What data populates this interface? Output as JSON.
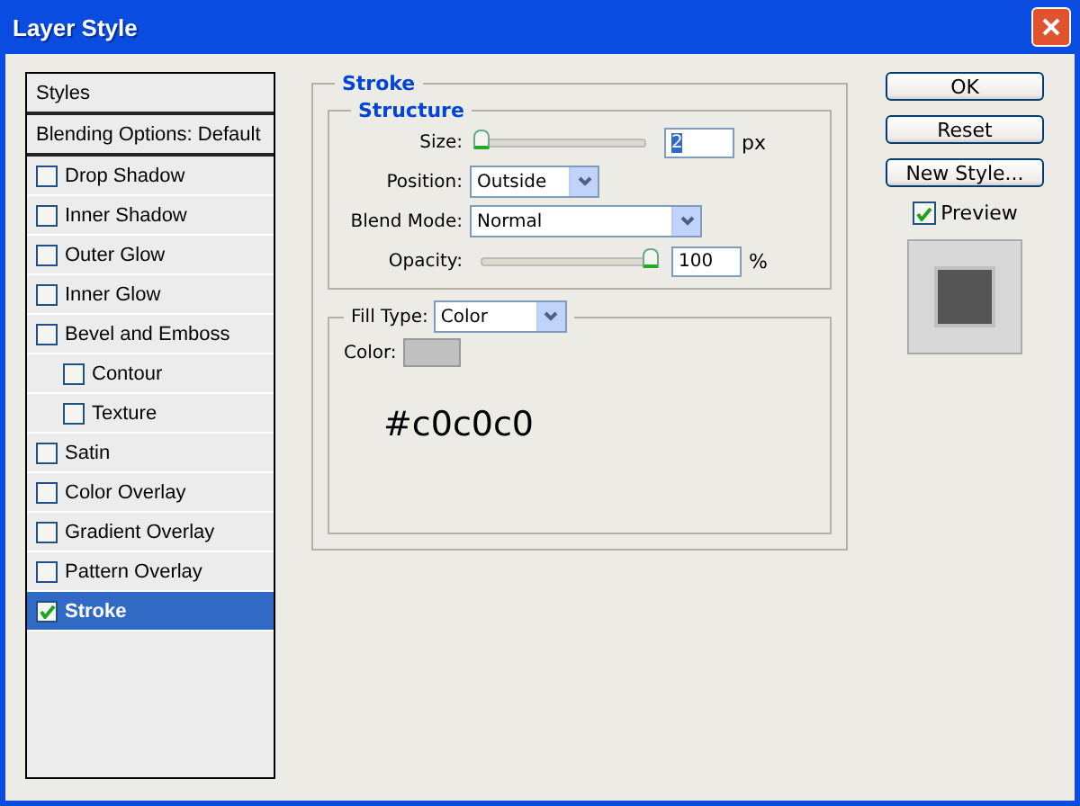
{
  "window": {
    "title": "Layer Style"
  },
  "sidebar": {
    "items": [
      {
        "label": "Styles",
        "kind": "header",
        "selected": false
      },
      {
        "label": "Blending Options: Default",
        "kind": "header",
        "selected": false
      },
      {
        "label": "Drop Shadow",
        "kind": "effect",
        "checked": false,
        "selected": false
      },
      {
        "label": "Inner Shadow",
        "kind": "effect",
        "checked": false,
        "selected": false
      },
      {
        "label": "Outer Glow",
        "kind": "effect",
        "checked": false,
        "selected": false
      },
      {
        "label": "Inner Glow",
        "kind": "effect",
        "checked": false,
        "selected": false
      },
      {
        "label": "Bevel and Emboss",
        "kind": "effect",
        "checked": false,
        "selected": false,
        "children": [
          {
            "label": "Contour",
            "checked": false,
            "selected": false
          },
          {
            "label": "Texture",
            "checked": false,
            "selected": false
          }
        ]
      },
      {
        "label": "Satin",
        "kind": "effect",
        "checked": false,
        "selected": false
      },
      {
        "label": "Color Overlay",
        "kind": "effect",
        "checked": false,
        "selected": false
      },
      {
        "label": "Gradient Overlay",
        "kind": "effect",
        "checked": false,
        "selected": false
      },
      {
        "label": "Pattern Overlay",
        "kind": "effect",
        "checked": false,
        "selected": false
      },
      {
        "label": "Stroke",
        "kind": "effect",
        "checked": true,
        "selected": true
      }
    ]
  },
  "stroke": {
    "title": "Stroke",
    "structure": {
      "title": "Structure",
      "size": {
        "label": "Size:",
        "level": 0,
        "value": "2",
        "unit": "px"
      },
      "position": {
        "label": "Position:",
        "value": "Outside"
      },
      "blend_mode": {
        "label": "Blend Mode:",
        "value": "Normal"
      },
      "opacity": {
        "label": "Opacity:",
        "level": 1,
        "value": "100",
        "unit": "%"
      }
    },
    "fill": {
      "label": "Fill Type:",
      "value": "Color",
      "color_label": "Color:",
      "color": "#c0c0c0",
      "note": "#c0c0c0"
    }
  },
  "buttons": [
    "OK",
    "Reset",
    "New Style..."
  ],
  "preview": {
    "label": "Preview",
    "checked": true
  }
}
